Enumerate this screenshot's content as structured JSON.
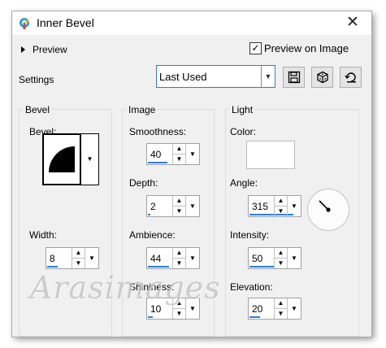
{
  "window": {
    "title": "Inner Bevel",
    "close_glyph": "✕"
  },
  "header": {
    "preview_label": "Preview",
    "preview_on_image_label": "Preview on Image",
    "preview_on_image_checked": true,
    "settings_label": "Settings",
    "preset_value": "Last Used"
  },
  "toolbar_icons": [
    "save-preset-icon",
    "randomize-icon",
    "reset-icon"
  ],
  "bevel_group": {
    "title": "Bevel",
    "bevel_label": "Bevel:",
    "width_label": "Width:",
    "width_value": "8"
  },
  "image_group": {
    "title": "Image",
    "smoothness_label": "Smoothness:",
    "smoothness_value": "40",
    "depth_label": "Depth:",
    "depth_value": "2",
    "ambience_label": "Ambience:",
    "ambience_value": "44",
    "shininess_label": "Shininess:",
    "shininess_value": "10"
  },
  "light_group": {
    "title": "Light",
    "color_label": "Color:",
    "color_value": "#ffffff",
    "angle_label": "Angle:",
    "angle_value": "315",
    "intensity_label": "Intensity:",
    "intensity_value": "50",
    "elevation_label": "Elevation:",
    "elevation_value": "20"
  },
  "watermark": "Arasimages",
  "colors": {
    "accent": "#2a7fd4",
    "dialog_bg": "#f0f0f0"
  }
}
